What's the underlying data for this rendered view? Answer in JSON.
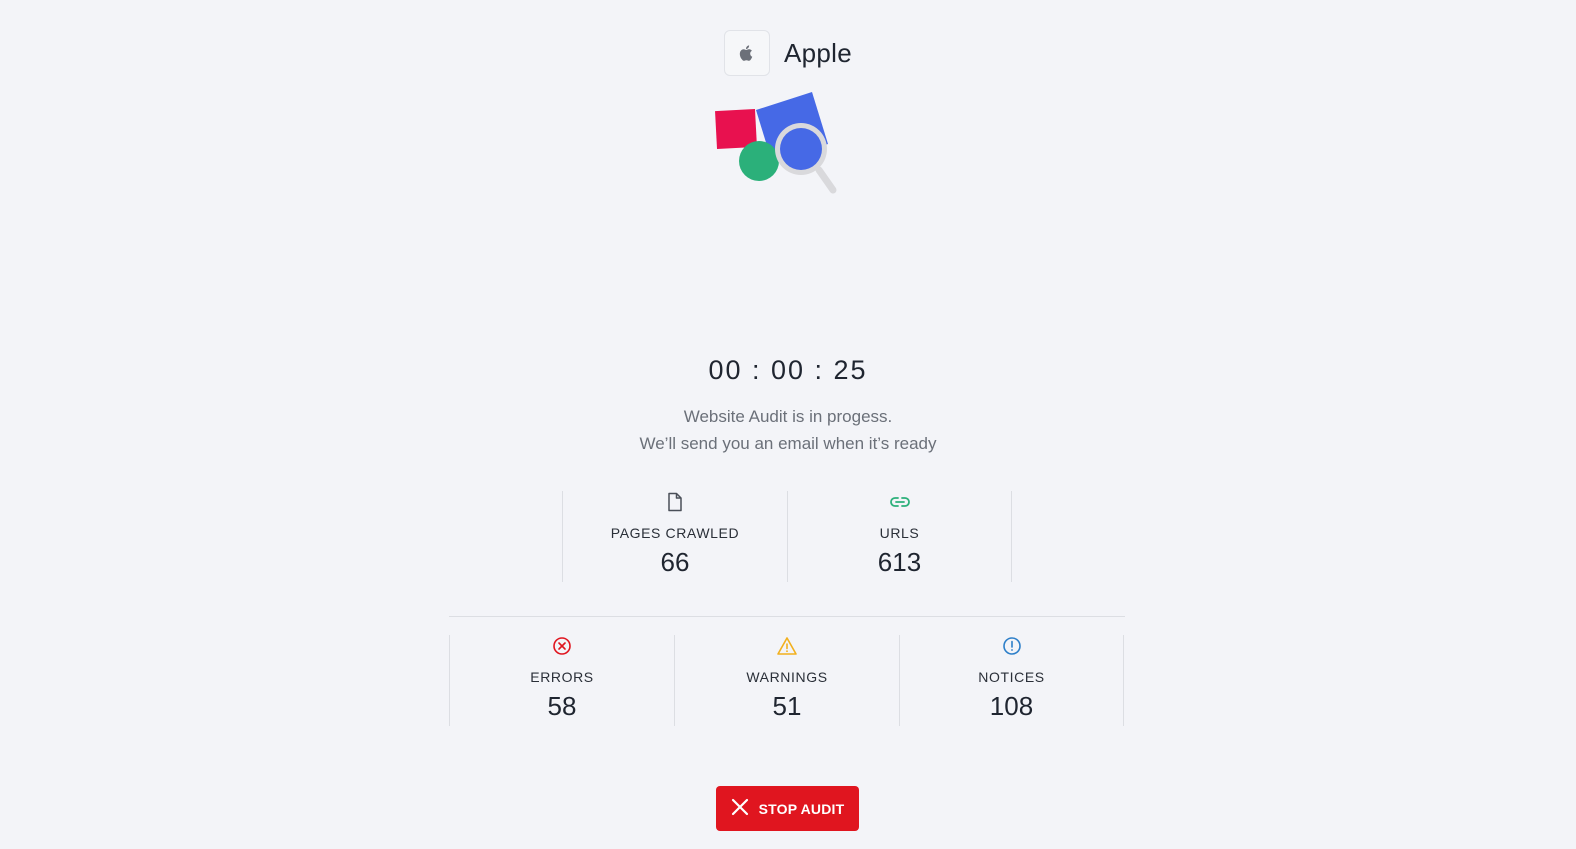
{
  "brand": {
    "name": "Apple",
    "logo_icon": "apple-logo-icon"
  },
  "illustration": {
    "icon": "website-audit-illustration",
    "colors": {
      "red_square": "#e8114f",
      "blue_shape": "#4669e6",
      "green_circle": "#2bb07a",
      "magnifier": "#d9d9dc"
    }
  },
  "timer": {
    "display": "00 : 00 : 25"
  },
  "status": {
    "line1": "Website Audit is in progess.",
    "line2": "We’ll send you an email when it’s ready"
  },
  "stats_top": [
    {
      "label": "PAGES CRAWLED",
      "value": "66",
      "icon": "document-icon",
      "color": "#4a4f58"
    },
    {
      "label": "URLS",
      "value": "613",
      "icon": "link-icon",
      "color": "#2bb07a"
    }
  ],
  "stats_bottom": [
    {
      "label": "ERRORS",
      "value": "58",
      "icon": "error-circle-icon",
      "color": "#e0151f"
    },
    {
      "label": "WARNINGS",
      "value": "51",
      "icon": "warning-triangle-icon",
      "color": "#f2b01e"
    },
    {
      "label": "NOTICES",
      "value": "108",
      "icon": "info-circle-icon",
      "color": "#2d7fc9"
    }
  ],
  "actions": {
    "stop_label": "STOP AUDIT",
    "stop_icon": "close-icon",
    "stop_color": "#e0151f"
  }
}
